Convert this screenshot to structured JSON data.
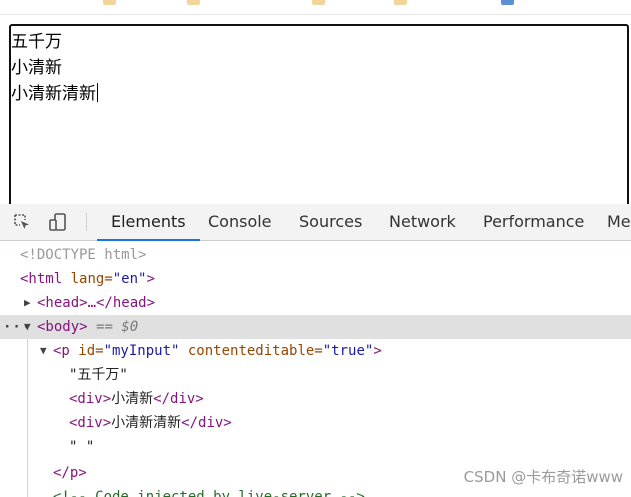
{
  "preview": {
    "lines": [
      "五千万",
      "小清新",
      "小清新清新"
    ]
  },
  "devtools": {
    "tabs": [
      {
        "label": "Elements",
        "active": true
      },
      {
        "label": "Console",
        "active": false
      },
      {
        "label": "Sources",
        "active": false
      },
      {
        "label": "Network",
        "active": false
      },
      {
        "label": "Performance",
        "active": false
      },
      {
        "label": "Me",
        "active": false
      }
    ],
    "tree": {
      "doctype": "<!DOCTYPE html>",
      "html_open_tag": "<html",
      "html_attr_name": " lang=",
      "html_attr_value": "\"en\"",
      "html_close_bracket": ">",
      "head_collapsed": "<head>…</head>",
      "body_dots": "···",
      "body_tag": "<body>",
      "body_marker": "== $0",
      "p_open": "<p",
      "p_attr1_name": " id=",
      "p_attr1_value": "\"myInput\"",
      "p_attr2_name": " contenteditable=",
      "p_attr2_value": "\"true\"",
      "p_close_bracket": ">",
      "text1": "\"五千万\"",
      "div1_open": "<div>",
      "div1_text": "小清新",
      "div1_close": "</div>",
      "div2_open": "<div>",
      "div2_text": "小清新清新",
      "div2_close": "</div>",
      "text2": "\" \"",
      "p_end": "</p>",
      "comment": "<!-- Code injected by live-server -->"
    }
  },
  "watermark": "CSDN @卡布奇诺www"
}
